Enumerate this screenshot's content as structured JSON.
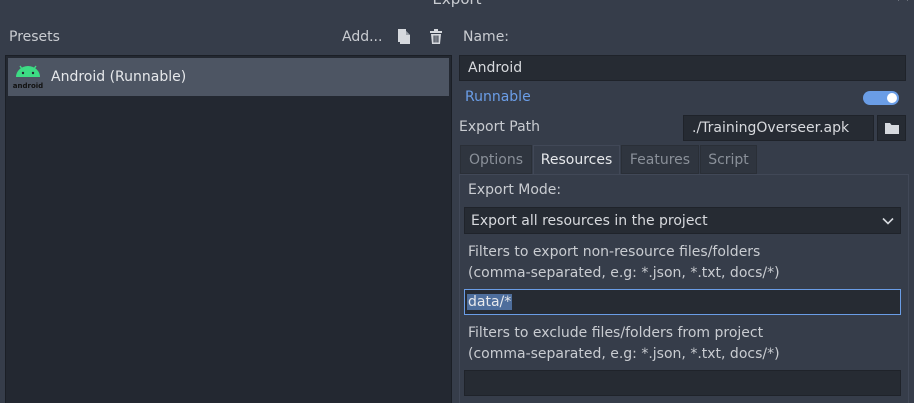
{
  "window": {
    "title": "Export"
  },
  "presets": {
    "label": "Presets",
    "add_label": "Add...",
    "items": [
      {
        "label": "Android (Runnable)",
        "icon": "android-icon",
        "icon_text": "android"
      }
    ]
  },
  "details": {
    "name_label": "Name:",
    "name_value": "Android",
    "runnable_label": "Runnable",
    "runnable_on": true,
    "export_path_label": "Export Path",
    "export_path_value": "./TrainingOverseer.apk"
  },
  "tabs": [
    {
      "label": "Options",
      "active": false
    },
    {
      "label": "Resources",
      "active": true
    },
    {
      "label": "Features",
      "active": false
    },
    {
      "label": "Script",
      "active": false
    }
  ],
  "resources": {
    "export_mode_label": "Export Mode:",
    "export_mode_value": "Export all resources in the project",
    "filters_label_line1": "Filters to export non-resource files/folders",
    "filters_label_line2": "(comma-separated, e.g: *.json, *.txt, docs/*)",
    "filters_value": "data/*",
    "exclude_label_line1": "Filters to exclude files/folders from project",
    "exclude_label_line2": "(comma-separated, e.g: *.json, *.txt, docs/*)",
    "exclude_value": ""
  },
  "colors": {
    "accent": "#6a9de6",
    "background": "#363d4a",
    "android_green": "#3ddc84"
  }
}
